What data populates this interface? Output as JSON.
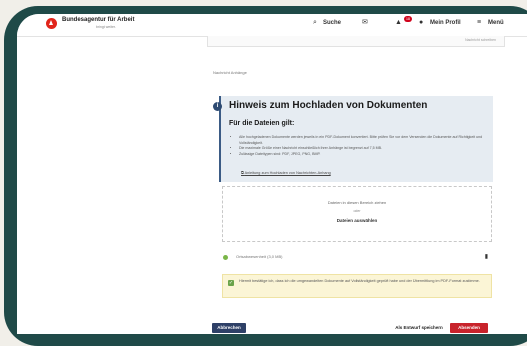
{
  "header": {
    "brand": "Bundesagentur für Arbeit",
    "brand_sub": "bringt weiter.",
    "search_label": "Suche",
    "notification_count": "18",
    "profile_label": "Mein Profil",
    "menu_label": "Menü"
  },
  "form": {
    "stub_text": "Nachricht schreiben",
    "section_label": "Nachricht Anhänge"
  },
  "hint": {
    "title": "Hinweis zum Hochladen von Dokumenten",
    "subtitle": "Für die Dateien gilt:",
    "items": [
      "Alle hochgeladenen Dokumente werden jeweils in ein PDF-Dokument konvertiert. Bitte prüfen Sie vor dem Versenden die Dokumente auf Richtigkeit und Vollständigkeit.",
      "Die maximale Größe einer Nachricht einschließlich ihrer Anhänge ist begrenzt auf 7,5 MB.",
      "Zulässige Dateitypen sind: PDF, JPEG, PNG, BMP."
    ],
    "link": "Anleitung zum Hochladen von Nachrichten-Anhang"
  },
  "dropzone": {
    "line1": "Dateien in diesen Bereich ziehen",
    "or": "oder",
    "button": "Dateien auswählen"
  },
  "file": {
    "name": "Ortsabwesenheit (3,0 MB)"
  },
  "confirm": {
    "text": "Hiermit bestätige ich, dass ich die umgewandelten Dokumente auf Vollständigkeit geprüft habe und der Übermittlung im PDF-Format zustimme."
  },
  "actions": {
    "cancel": "Abbrechen",
    "draft": "Als Entwurf speichern",
    "submit": "Absenden"
  },
  "colors": {
    "device_frame": "#1f4a48",
    "accent_blue": "#2e4067",
    "accent_red": "#c8232b",
    "hint_background": "#e6ecf2",
    "confirm_background": "#fbf5d6"
  },
  "icons": [
    "logo-icon",
    "search-icon",
    "mail-icon",
    "bell-icon",
    "user-icon",
    "menu-icon",
    "info-icon",
    "trash-icon",
    "checkbox-checked-icon"
  ]
}
